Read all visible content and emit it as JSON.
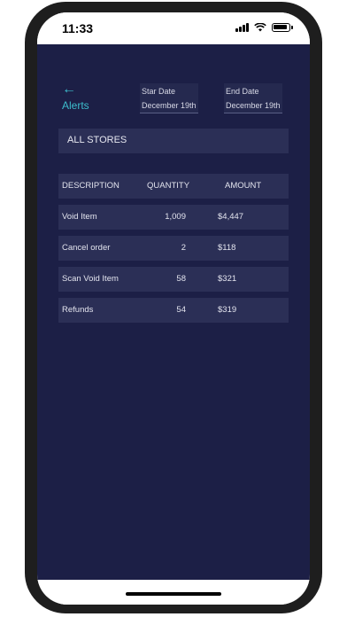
{
  "status_bar": {
    "time": "11:33"
  },
  "nav": {
    "back_label": "Alerts"
  },
  "start_date": {
    "label": "Star Date",
    "value": "December 19th"
  },
  "end_date": {
    "label": "End Date",
    "value": "December 19th"
  },
  "store_selector": {
    "value": "ALL STORES"
  },
  "table": {
    "headers": [
      "DESCRIPTION",
      "QUANTITY",
      "AMOUNT"
    ],
    "rows": [
      {
        "description": "Void Item",
        "quantity": "1,009",
        "amount": "$4,447"
      },
      {
        "description": "Cancel order",
        "quantity": "2",
        "amount": "$118"
      },
      {
        "description": "Scan Void Item",
        "quantity": "58",
        "amount": "$321"
      },
      {
        "description": "Refunds",
        "quantity": "54",
        "amount": "$319"
      }
    ]
  },
  "colors": {
    "background": "#1c1f46",
    "accent": "#3dbdcc",
    "card": "#2b2f56"
  }
}
